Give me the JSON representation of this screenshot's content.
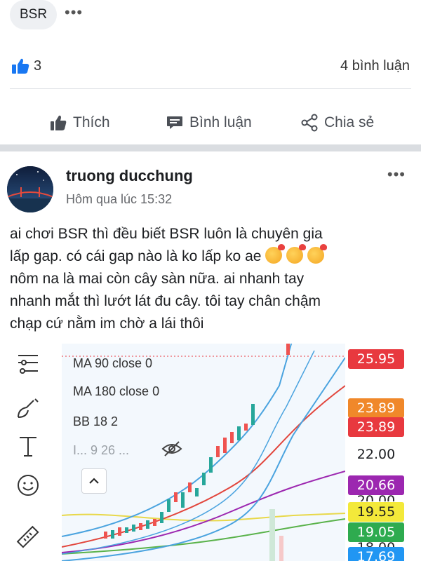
{
  "tag": {
    "label": "BSR",
    "more": "•••"
  },
  "reactions": {
    "like_count": "3",
    "comment_count": "4 bình luận"
  },
  "actions": {
    "like": "Thích",
    "comment": "Bình luận",
    "share": "Chia sẻ"
  },
  "post": {
    "author": "truong ducchung",
    "timestamp": "Hôm qua lúc 15:32",
    "more": "•••",
    "lines": [
      "ai chơi BSR thì đều biết BSR luôn là chuyên gia",
      "lấp gap. có cái gap nào là ko lấp ko ae",
      "nôm na là mai còn cây sàn nữa. ai nhanh tay",
      "nhanh mắt thì lướt lát đu cây. tôi tay chân chậm",
      "chạp cứ nằm im chờ a lái thôi"
    ]
  },
  "chart": {
    "legend": [
      {
        "text": "MA 90 close 0"
      },
      {
        "text": "MA 180 close 0"
      },
      {
        "text": "BB 18 2"
      },
      {
        "text": "I... 9 26 ..."
      }
    ],
    "price_labels": [
      {
        "text": "25.95",
        "color": "#e8393f"
      },
      {
        "text": "23.89",
        "color": "#f0882a"
      },
      {
        "text": "23.89",
        "color": "#e8393f"
      },
      {
        "text": "22.00",
        "color": ""
      },
      {
        "text": "20.66",
        "color": "#9c27b0"
      },
      {
        "text": "20.00",
        "color": ""
      },
      {
        "text": "19.55",
        "color": "#f3e93a"
      },
      {
        "text": "19.05",
        "color": "#2eab4f"
      },
      {
        "text": "18.00",
        "color": ""
      },
      {
        "text": "17.69",
        "color": "#2196f3"
      }
    ]
  },
  "colors": {
    "like_blue": "#1877f2",
    "candle_green": "#26a69a",
    "candle_red": "#ef5350",
    "bb_blue": "#4aa3df",
    "ma_red": "#e2453c",
    "ma_purple": "#9c27b0",
    "ma_green": "#59b24a",
    "ma_yellow": "#e8d84a"
  }
}
